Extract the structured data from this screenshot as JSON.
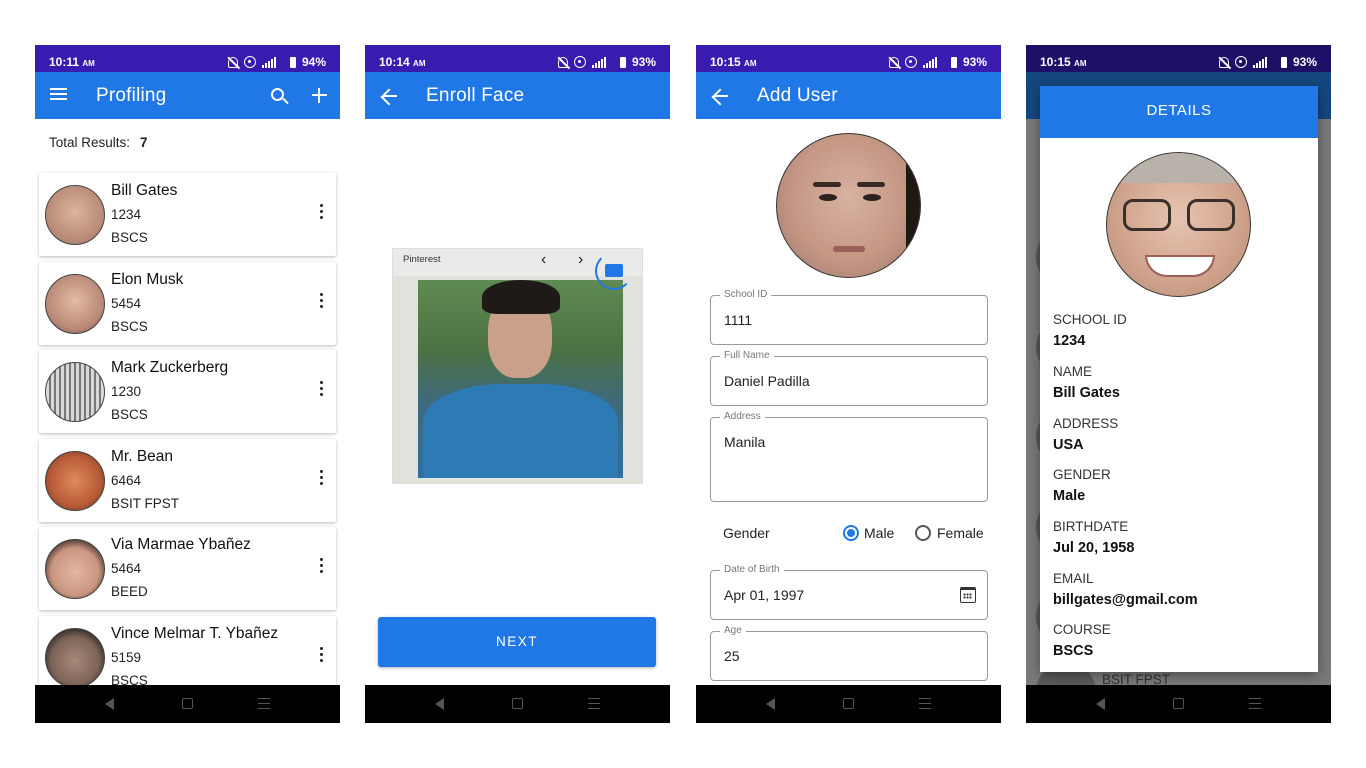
{
  "screens": {
    "profiling": {
      "status": {
        "time": "10:11",
        "ampm": "AM",
        "battery": "94%"
      },
      "title": "Profiling",
      "total_label": "Total Results:",
      "total_value": "7",
      "profiles": [
        {
          "name": "Bill Gates",
          "id": "1234",
          "course": "BSCS",
          "avatar_color": "#c99a84"
        },
        {
          "name": "Elon Musk",
          "id": "5454",
          "course": "BSCS",
          "avatar_color": "#b98876"
        },
        {
          "name": "Mark Zuckerberg",
          "id": "1230",
          "course": "BSCS",
          "avatar_color": "#8f8f8f"
        },
        {
          "name": "Mr. Bean",
          "id": "6464",
          "course": "BSIT FPST",
          "avatar_color": "#b85b37"
        },
        {
          "name": "Via Marmae Ybañez",
          "id": "5464",
          "course": "BEED",
          "avatar_color": "#c99580"
        },
        {
          "name": "Vince Melmar T. Ybañez",
          "id": "5159",
          "course": "BSCS",
          "avatar_color": "#7c6458"
        }
      ]
    },
    "enroll": {
      "status": {
        "time": "10:14",
        "ampm": "AM",
        "battery": "93%"
      },
      "title": "Enroll Face",
      "photo_source": "Pinterest",
      "next_label": "NEXT"
    },
    "add_user": {
      "status": {
        "time": "10:15",
        "ampm": "AM",
        "battery": "93%"
      },
      "title": "Add User",
      "fields": {
        "school_id": {
          "label": "School ID",
          "value": "1111"
        },
        "full_name": {
          "label": "Full Name",
          "value": "Daniel Padilla"
        },
        "address": {
          "label": "Address",
          "value": "Manila"
        },
        "dob": {
          "label": "Date of Birth",
          "value": "Apr 01, 1997"
        },
        "age": {
          "label": "Age",
          "value": "25"
        }
      },
      "gender": {
        "label": "Gender",
        "options": [
          "Male",
          "Female"
        ],
        "selected": "Male"
      }
    },
    "details": {
      "status": {
        "time": "10:15",
        "ampm": "AM",
        "battery": "93%"
      },
      "header": "DETAILS",
      "items": [
        {
          "key": "SCHOOL ID",
          "value": "1234"
        },
        {
          "key": "NAME",
          "value": "Bill Gates"
        },
        {
          "key": "ADDRESS",
          "value": "USA"
        },
        {
          "key": "GENDER",
          "value": "Male"
        },
        {
          "key": "BIRTHDATE",
          "value": "Jul 20, 1958"
        },
        {
          "key": "EMAIL",
          "value": "billgates@gmail.com"
        },
        {
          "key": "COURSE",
          "value": "BSCS"
        }
      ],
      "background_peek": "BSIT FPST"
    }
  },
  "colors": {
    "status_bar": "#3a1bb0",
    "app_bar": "#1f78e6",
    "nav_bar": "#000000"
  }
}
